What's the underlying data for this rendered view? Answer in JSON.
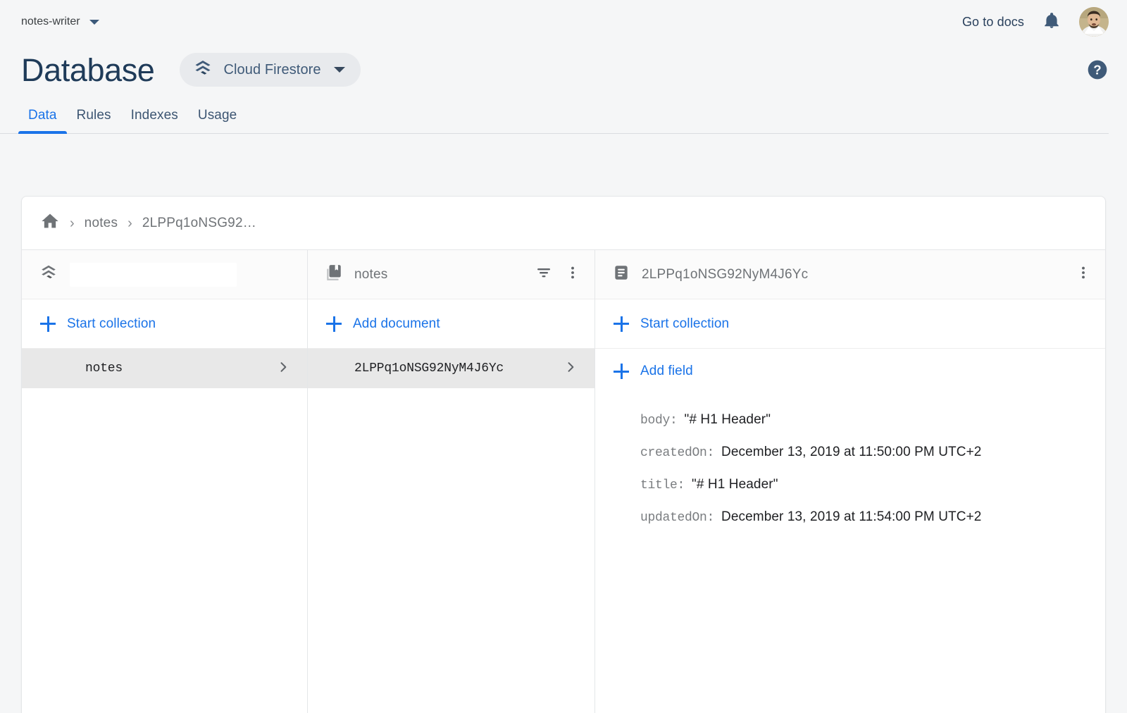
{
  "topbar": {
    "project_name": "notes-writer",
    "project_switcher_icon": "chevron-down-icon",
    "go_to_docs_label": "Go to docs",
    "notifications_icon": "bell-icon",
    "avatar_icon": "user-avatar"
  },
  "header": {
    "title": "Database",
    "db_chip": {
      "icon": "cloud-firestore-icon",
      "label": "Cloud Firestore",
      "caret_icon": "chevron-down-icon"
    },
    "help_icon": "help-circle-icon"
  },
  "tabs": [
    {
      "label": "Data",
      "active": true
    },
    {
      "label": "Rules",
      "active": false
    },
    {
      "label": "Indexes",
      "active": false
    },
    {
      "label": "Usage",
      "active": false
    }
  ],
  "breadcrumb": {
    "home_icon": "home-icon",
    "separator": "›",
    "items": [
      {
        "label": "notes"
      },
      {
        "label": "2LPPq1oNSG92…"
      }
    ]
  },
  "panels": {
    "root": {
      "head_icon": "cloud-firestore-icon",
      "head_title": "",
      "redacted": true,
      "action_label": "Start collection",
      "action_icon": "plus-icon",
      "rows": [
        {
          "label": "notes",
          "selected": true,
          "chevron_icon": "chevron-right-icon"
        }
      ]
    },
    "collection": {
      "head_icon": "collection-icon",
      "head_title": "notes",
      "filter_icon": "filter-icon",
      "menu_icon": "more-vert-icon",
      "action_label": "Add document",
      "action_icon": "plus-icon",
      "rows": [
        {
          "label": "2LPPq1oNSG92NyM4J6Yc",
          "selected": true,
          "chevron_icon": "chevron-right-icon"
        }
      ]
    },
    "document": {
      "head_icon": "document-icon",
      "head_title": "2LPPq1oNSG92NyM4J6Yc",
      "menu_icon": "more-vert-icon",
      "start_collection_label": "Start collection",
      "start_collection_icon": "plus-icon",
      "add_field_label": "Add field",
      "add_field_icon": "plus-icon",
      "fields": [
        {
          "key": "body:",
          "value": "\"# H1 Header\""
        },
        {
          "key": "createdOn:",
          "value": "December 13, 2019 at 11:50:00 PM UTC+2"
        },
        {
          "key": "title:",
          "value": "\"# H1 Header\""
        },
        {
          "key": "updatedOn:",
          "value": "December 13, 2019 at 11:54:00 PM UTC+2"
        }
      ]
    }
  },
  "colors": {
    "accent_blue": "#1a73e8",
    "title_navy": "#1f3b59",
    "page_background": "#f5f6f7",
    "selected_row": "#e8e8e8",
    "panel_header": "#fbfbfb"
  }
}
